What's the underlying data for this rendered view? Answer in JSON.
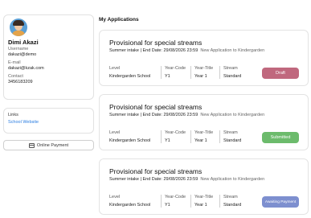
{
  "profile": {
    "name": "Dimi Akazi",
    "username_label": "Username",
    "username": "dakazi@demo",
    "email_label": "E-mail",
    "email": "dakazi@kzak.com",
    "contact_label": "Contact",
    "contact": "3456183209"
  },
  "links": {
    "title": "Links",
    "school_website": "School Website"
  },
  "online_payment": "Online Payment",
  "main": {
    "title": "My Applications"
  },
  "applications": [
    {
      "title": "Provisional for special streams",
      "intake": "Summer intake | End Date: 29/08/2026 23:59",
      "subtitle": "New Application to Kindergarden",
      "level_label": "Level",
      "level": "Kindergarden School",
      "year_code_label": "Year-Code",
      "year_code": "Y1",
      "year_title_label": "Year-Title",
      "year_title": "Year 1",
      "stream_label": "Stream",
      "stream": "Standard",
      "status": "Draft",
      "status_color": "#c0687e"
    },
    {
      "title": "Provisional for special streams",
      "intake": "Summer intake | End Date: 29/08/2026 23:59",
      "subtitle": "New Application to Kindergarden",
      "level_label": "Level",
      "level": "Kindergarden School",
      "year_code_label": "Year-Code",
      "year_code": "Y1",
      "year_title_label": "Year-Title",
      "year_title": "Year 1",
      "stream_label": "Stream",
      "stream": "Standard",
      "status": "Submitted",
      "status_color": "#6cbb6c"
    },
    {
      "title": "Provisional for special streams",
      "intake": "Summer intake | End Date: 29/08/2026 23:59",
      "subtitle": "New Application to Kindergarden",
      "level_label": "Level",
      "level": "Kindergarden School",
      "year_code_label": "Year-Code",
      "year_code": "Y1",
      "year_title_label": "Year-Title",
      "year_title": "Year 1",
      "stream_label": "Stream",
      "stream": "Standard",
      "status": "Awaiting Payment",
      "status_color": "#7d8fcf"
    }
  ]
}
